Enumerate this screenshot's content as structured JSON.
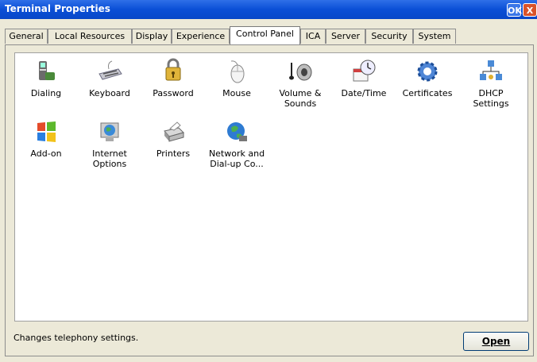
{
  "window": {
    "title": "Terminal Properties",
    "ok_label": "OK",
    "close_label": "X"
  },
  "tabs": [
    {
      "label": "General"
    },
    {
      "label": "Local Resources"
    },
    {
      "label": "Display"
    },
    {
      "label": "Experience"
    },
    {
      "label": "Control Panel",
      "active": true
    },
    {
      "label": "ICA"
    },
    {
      "label": "Server"
    },
    {
      "label": "Security"
    },
    {
      "label": "System"
    }
  ],
  "items": [
    {
      "label": "Dialing",
      "icon": "phone-icon"
    },
    {
      "label": "Keyboard",
      "icon": "keyboard-icon"
    },
    {
      "label": "Password",
      "icon": "keys-icon"
    },
    {
      "label": "Mouse",
      "icon": "mouse-icon"
    },
    {
      "label": "Volume &\nSounds",
      "icon": "speaker-icon"
    },
    {
      "label": "Date/Time",
      "icon": "clock-calendar-icon"
    },
    {
      "label": "Certificates",
      "icon": "gear-icon"
    },
    {
      "label": "DHCP\nSettings",
      "icon": "network-icon"
    },
    {
      "label": "Add-on",
      "icon": "windows-logo-icon"
    },
    {
      "label": "Internet\nOptions",
      "icon": "globe-icon"
    },
    {
      "label": "Printers",
      "icon": "printer-icon"
    },
    {
      "label": "Network and\nDial-up Co...",
      "icon": "network-globe-icon"
    }
  ],
  "status_text": "Changes telephony settings.",
  "open_label": "Open",
  "colors": {
    "title_bar": "#0a4fd6",
    "dialog_bg": "#ece9d8",
    "panel_bg": "#ffffff"
  }
}
